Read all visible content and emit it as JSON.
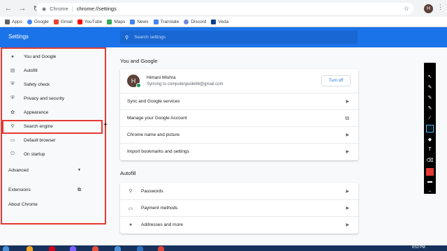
{
  "browser": {
    "back_icon": "back-arrow-icon",
    "forward_icon": "forward-arrow-icon",
    "reload_icon": "reload-icon",
    "site_label": "Chrome",
    "url": "chrome://settings",
    "avatar_letter": "H"
  },
  "bookmarks": [
    {
      "label": "Apps",
      "color": "#5f6368"
    },
    {
      "label": "Google",
      "color": "#4285f4"
    },
    {
      "label": "Gmail",
      "color": "#ea4335"
    },
    {
      "label": "YouTube",
      "color": "#ff0000"
    },
    {
      "label": "Maps",
      "color": "#34a853"
    },
    {
      "label": "News",
      "color": "#4285f4"
    },
    {
      "label": "Translate",
      "color": "#4285f4"
    },
    {
      "label": "Discord",
      "color": "#7289da"
    },
    {
      "label": "Veda",
      "color": "#0b3d91"
    }
  ],
  "header": {
    "title": "Settings",
    "search_placeholder": "Search settings"
  },
  "sidebar": {
    "items": [
      {
        "label": "You and Google",
        "icon": "person-icon"
      },
      {
        "label": "Autofill",
        "icon": "clipboard-icon"
      },
      {
        "label": "Safety check",
        "icon": "shield-icon"
      },
      {
        "label": "Privacy and security",
        "icon": "shield-lock-icon"
      },
      {
        "label": "Appearance",
        "icon": "palette-icon"
      },
      {
        "label": "Search engine",
        "icon": "search-icon"
      },
      {
        "label": "Default browser",
        "icon": "browser-icon"
      },
      {
        "label": "On startup",
        "icon": "power-icon"
      }
    ],
    "advanced": "Advanced",
    "extensions": "Extensions",
    "about": "About Chrome"
  },
  "you_and_google": {
    "title": "You and Google",
    "profile_letter": "H",
    "profile_name": "Himani Mishra",
    "sync_text": "Syncing to computerguide66@gmail.com",
    "turn_off": "Turn off",
    "rows": [
      "Sync and Google services",
      "Manage your Google Account",
      "Chrome name and picture",
      "Import bookmarks and settings"
    ]
  },
  "autofill": {
    "title": "Autofill",
    "rows": [
      {
        "label": "Passwords",
        "icon": "key-icon"
      },
      {
        "label": "Payment methods",
        "icon": "credit-card-icon"
      },
      {
        "label": "Addresses and more",
        "icon": "location-pin-icon"
      }
    ]
  },
  "colors": {
    "accent": "#1a73e8",
    "highlight": "#e53935"
  },
  "taskbar": {
    "time": "8:52 PM"
  }
}
